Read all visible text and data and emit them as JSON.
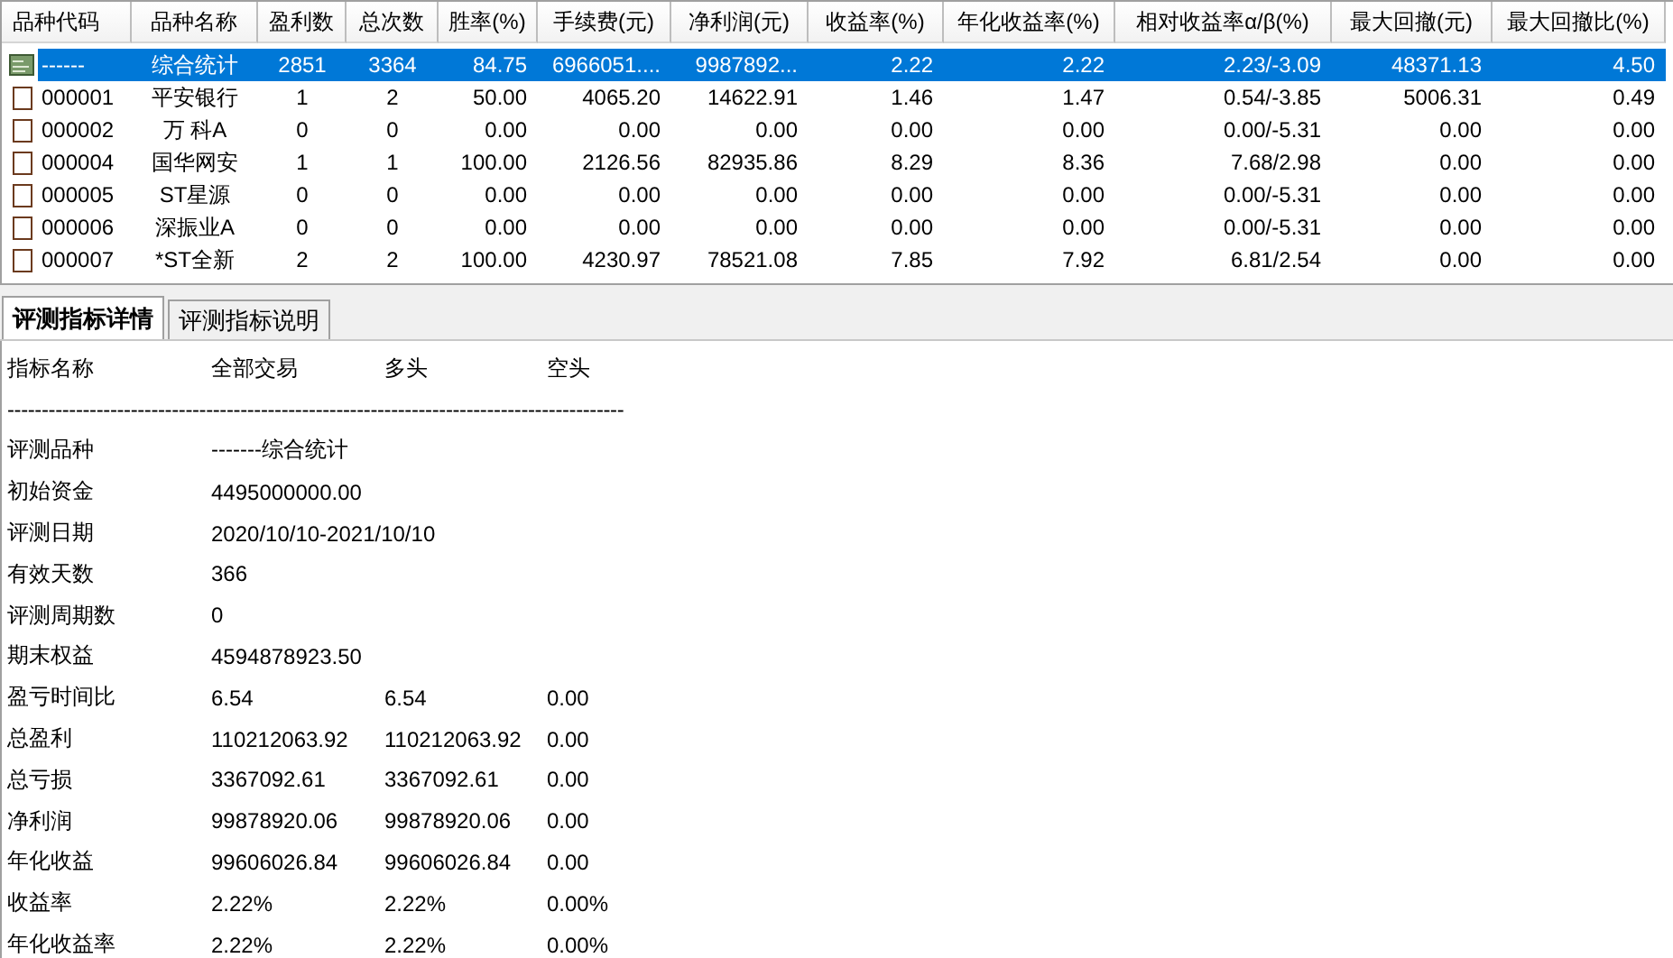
{
  "table": {
    "columns": [
      "品种代码",
      "品种名称",
      "盈利数",
      "总次数",
      "胜率(%)",
      "手续费(元)",
      "净利润(元)",
      "收益率(%)",
      "年化收益率(%)",
      "相对收益率α/β(%)",
      "最大回撤(元)",
      "最大回撤比(%)"
    ],
    "rows": [
      {
        "kind": "summary",
        "selected": true,
        "cells": [
          "------",
          "综合统计",
          "2851",
          "3364",
          "84.75",
          "6966051....",
          "9987892...",
          "2.22",
          "2.22",
          "2.23/-3.09",
          "48371.13",
          "4.50"
        ]
      },
      {
        "kind": "stock",
        "selected": false,
        "cells": [
          "000001",
          "平安银行",
          "1",
          "2",
          "50.00",
          "4065.20",
          "14622.91",
          "1.46",
          "1.47",
          "0.54/-3.85",
          "5006.31",
          "0.49"
        ]
      },
      {
        "kind": "stock",
        "selected": false,
        "cells": [
          "000002",
          "万 科A",
          "0",
          "0",
          "0.00",
          "0.00",
          "0.00",
          "0.00",
          "0.00",
          "0.00/-5.31",
          "0.00",
          "0.00"
        ]
      },
      {
        "kind": "stock",
        "selected": false,
        "cells": [
          "000004",
          "国华网安",
          "1",
          "1",
          "100.00",
          "2126.56",
          "82935.86",
          "8.29",
          "8.36",
          "7.68/2.98",
          "0.00",
          "0.00"
        ]
      },
      {
        "kind": "stock",
        "selected": false,
        "cells": [
          "000005",
          "ST星源",
          "0",
          "0",
          "0.00",
          "0.00",
          "0.00",
          "0.00",
          "0.00",
          "0.00/-5.31",
          "0.00",
          "0.00"
        ]
      },
      {
        "kind": "stock",
        "selected": false,
        "cells": [
          "000006",
          "深振业A",
          "0",
          "0",
          "0.00",
          "0.00",
          "0.00",
          "0.00",
          "0.00",
          "0.00/-5.31",
          "0.00",
          "0.00"
        ]
      },
      {
        "kind": "stock",
        "selected": false,
        "cells": [
          "000007",
          "*ST全新",
          "2",
          "2",
          "100.00",
          "4230.97",
          "78521.08",
          "7.85",
          "7.92",
          "6.81/2.54",
          "0.00",
          "0.00"
        ]
      }
    ]
  },
  "tabs": [
    {
      "label": "评测指标详情",
      "selected": true
    },
    {
      "label": "评测指标说明",
      "selected": false
    }
  ],
  "report": {
    "header": [
      "指标名称",
      "全部交易",
      "多头",
      "空头"
    ],
    "divider": "------------------------------------------------------------------------------------------",
    "lines": [
      {
        "label": "评测品种",
        "values": [
          "-------综合统计"
        ]
      },
      {
        "label": "初始资金",
        "values": [
          "4495000000.00"
        ]
      },
      {
        "label": "评测日期",
        "values": [
          "2020/10/10-2021/10/10"
        ]
      },
      {
        "label": "有效天数",
        "values": [
          "366"
        ]
      },
      {
        "label": "评测周期数",
        "values": [
          "0"
        ]
      },
      {
        "label": "期末权益",
        "values": [
          "4594878923.50"
        ]
      },
      {
        "label": "盈亏时间比",
        "values": [
          "6.54",
          "6.54",
          "0.00"
        ]
      },
      {
        "label": "总盈利",
        "values": [
          "110212063.92",
          "110212063.92",
          "0.00"
        ]
      },
      {
        "label": "总亏损",
        "values": [
          "3367092.61",
          "3367092.61",
          "0.00"
        ]
      },
      {
        "label": "净利润",
        "values": [
          "99878920.06",
          "99878920.06",
          "0.00"
        ]
      },
      {
        "label": "年化收益",
        "values": [
          "99606026.84",
          "99606026.84",
          "0.00"
        ]
      },
      {
        "label": "收益率",
        "values": [
          "2.22%",
          "2.22%",
          "0.00%"
        ]
      },
      {
        "label": "年化收益率",
        "values": [
          "2.22%",
          "2.22%",
          "0.00%"
        ]
      }
    ]
  }
}
